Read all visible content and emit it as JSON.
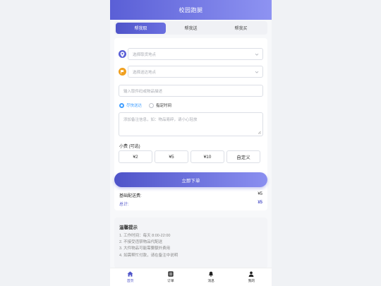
{
  "header": {
    "title": "校园跑腿"
  },
  "tabs": [
    {
      "label": "帮我取"
    },
    {
      "label": "帮我送"
    },
    {
      "label": "帮我买"
    }
  ],
  "form": {
    "pickup_placeholder": "选择取货地点",
    "delivery_placeholder": "选择送达地点",
    "item_placeholder": "输入取件码或物品描述",
    "time_options": [
      {
        "label": "尽快送达"
      },
      {
        "label": "指定时间"
      }
    ],
    "remark_placeholder": "添加备注信息，如：物品易碎，请小心轻放",
    "tip_label": "小费 (可选)",
    "tip_options": [
      {
        "label": "¥2"
      },
      {
        "label": "¥5"
      },
      {
        "label": "¥10"
      },
      {
        "label": "自定义"
      }
    ]
  },
  "submit_label": "立即下单",
  "fees": {
    "base_label": "基础配送费:",
    "base_value": "¥5",
    "total_label": "总计:",
    "total_value": "¥5"
  },
  "tips": {
    "title": "温馨提示",
    "items": [
      "1. 工作时间：每天 8:00-22:00",
      "2. 不接受违禁物品代配送",
      "3. 大件物品可能需要额外费用",
      "4. 如需帮忙付款，请在备注中说明"
    ]
  },
  "nav": [
    {
      "label": "首页",
      "icon": "home-icon"
    },
    {
      "label": "订单",
      "icon": "list-icon"
    },
    {
      "label": "消息",
      "icon": "bell-icon"
    },
    {
      "label": "我的",
      "icon": "user-icon"
    }
  ],
  "colors": {
    "primary": "#4f54c9",
    "accent_blue": "#409eff",
    "pickup_icon": "#5a5fd6",
    "delivery_icon": "#f0a020"
  }
}
